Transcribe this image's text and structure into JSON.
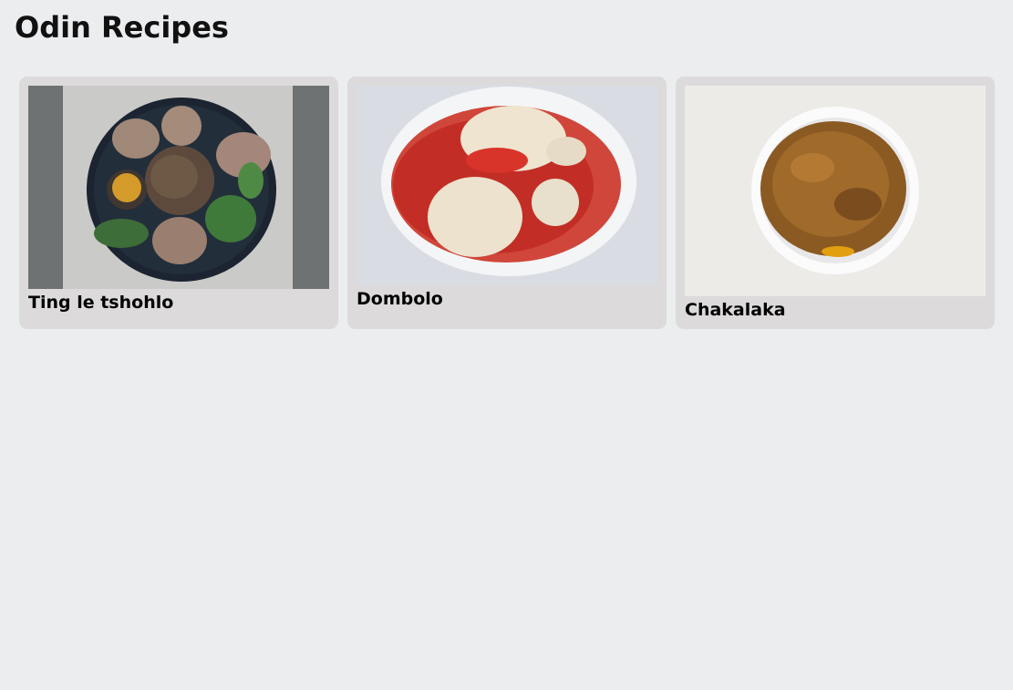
{
  "page": {
    "title": "Odin Recipes"
  },
  "recipes": [
    {
      "name": "Ting le tshohlo",
      "image": "ting-le-tshohlo-photo"
    },
    {
      "name": "Dombolo",
      "image": "dombolo-photo"
    },
    {
      "name": "Chakalaka",
      "image": "chakalaka-photo"
    }
  ],
  "colors": {
    "page_background": "#ecedef",
    "card_background": "#dcdadb",
    "text": "#000000"
  }
}
